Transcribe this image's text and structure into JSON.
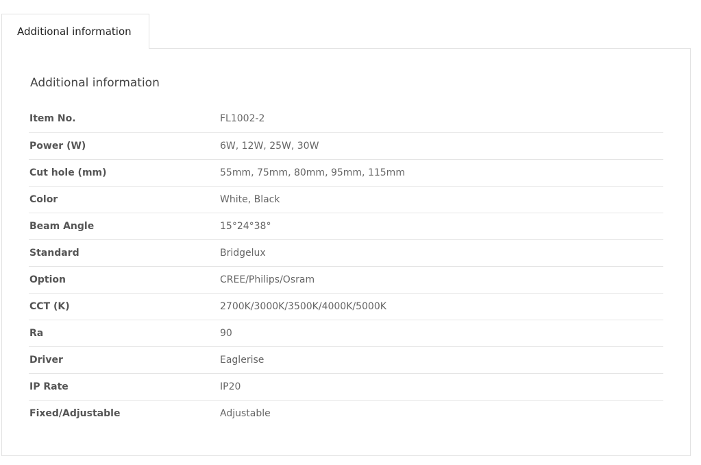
{
  "tabs": [
    {
      "label": "Additional information",
      "active": true
    }
  ],
  "panel": {
    "title": "Additional information",
    "rows": [
      {
        "label": "Item No.",
        "value": "FL1002-2"
      },
      {
        "label": "Power (W)",
        "value": "6W, 12W, 25W, 30W"
      },
      {
        "label": "Cut hole (mm)",
        "value": "55mm, 75mm, 80mm, 95mm, 115mm"
      },
      {
        "label": "Color",
        "value": "White, Black"
      },
      {
        "label": "Beam Angle",
        "value": "15°24°38°"
      },
      {
        "label": "Standard",
        "value": "Bridgelux"
      },
      {
        "label": "Option",
        "value": "CREE/Philips/Osram"
      },
      {
        "label": "CCT (K)",
        "value": "2700K/3000K/3500K/4000K/5000K"
      },
      {
        "label": "Ra",
        "value": "90"
      },
      {
        "label": "Driver",
        "value": "Eaglerise"
      },
      {
        "label": "IP Rate",
        "value": "IP20"
      },
      {
        "label": "Fixed/Adjustable",
        "value": "Adjustable"
      }
    ]
  }
}
